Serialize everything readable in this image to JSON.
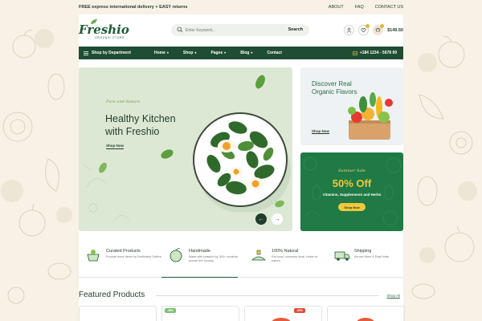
{
  "topbar": {
    "promo": "FREE express international delivery + EASY returns",
    "links": [
      "ABOUT",
      "FAQ",
      "CONTACT US"
    ]
  },
  "header": {
    "logo": "Freshio",
    "logo_sub": "ORGANIC STORE",
    "search_placeholder": "Enter Keyword...",
    "search_button": "Search",
    "cart_total": "$149.50"
  },
  "nav": {
    "department": "Shop by Department",
    "items": [
      "Home",
      "Shop",
      "Pages",
      "Blog",
      "Contact"
    ],
    "phone": "+184 1234 - 5678 99"
  },
  "hero": {
    "tagline": "Pure and Nature",
    "title": "Healthy Kitchen with Freshio",
    "shop": "Shop Now"
  },
  "promo1": {
    "title": "Discover Real Organic Flavors",
    "shop": "Shop Now"
  },
  "promo2": {
    "tag": "Summer Sale",
    "discount": "50% Off",
    "desc": "Vitamins, Supplements and Herbs",
    "button": "Shop Now"
  },
  "features": [
    {
      "title": "Curated Products",
      "desc": "Provide more Items by Dedicated Sellers"
    },
    {
      "title": "Handmade",
      "desc": "Made with passion by 300+ curators across the country."
    },
    {
      "title": "100% Natural",
      "desc": "Eat local, consume local, closer to nature."
    },
    {
      "title": "Shipping",
      "desc": "Across West & East India"
    }
  ],
  "featured": {
    "title": "Featured Products",
    "view_all": "Shop All",
    "badges": [
      "-36%",
      "-25%"
    ]
  },
  "colors": {
    "brand_green": "#1f4d33",
    "accent_yellow": "#f4c63a",
    "sale_red": "#e0493c",
    "badge_green": "#7cc26e"
  }
}
